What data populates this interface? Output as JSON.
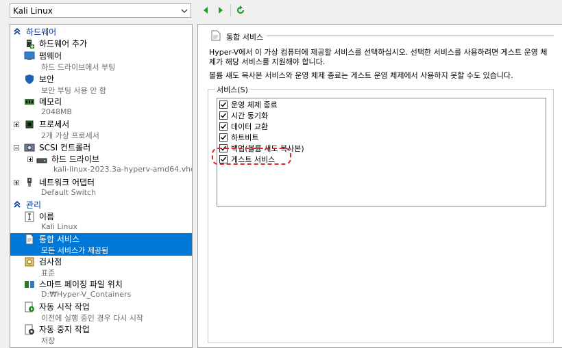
{
  "toolbar": {
    "vm_name": "Kali Linux",
    "back_icon": "arrow-left-icon",
    "forward_icon": "arrow-right-icon",
    "refresh_icon": "refresh-icon",
    "accent_color": "#1e9e2d"
  },
  "left": {
    "hardware_header": "하드웨어",
    "management_header": "관리",
    "items": [
      {
        "label": "하드웨어 추가",
        "sub": ""
      },
      {
        "label": "펌웨어",
        "sub": "하드 드라이브에서 부팅"
      },
      {
        "label": "보안",
        "sub": "보안 부팅 사용 안 함"
      },
      {
        "label": "메모리",
        "sub": "2048MB"
      },
      {
        "label": "프로세서",
        "sub": "2개 가상 프로세서"
      },
      {
        "label": "SCSI 컨트롤러",
        "sub": ""
      },
      {
        "label": "하드 드라이브",
        "sub": "kali-linux-2023.3a-hyperv-amd64.vhdx"
      },
      {
        "label": "네트워크 어댑터",
        "sub": "Default Switch"
      }
    ],
    "mgmt_items": [
      {
        "label": "이름",
        "sub": "Kali Linux"
      },
      {
        "label": "통합 서비스",
        "sub": "모든 서비스가 제공됨"
      },
      {
        "label": "검사점",
        "sub": "표준"
      },
      {
        "label": "스마트 페이징 파일 위치",
        "sub": "D:₩Hyper-V_Containers"
      },
      {
        "label": "자동 시작 작업",
        "sub": "이전에 실행 중인 경우 다시 시작"
      },
      {
        "label": "자동 중지 작업",
        "sub": "저장"
      }
    ],
    "selection_color": "#0078d7"
  },
  "right": {
    "title": "통합 서비스",
    "desc1": "Hyper-V에서 이 가상 컴퓨터에 제공할 서비스를 선택하십시오. 선택한 서비스를 사용하려면 게스트 운영 체제가 해당 서비스를 지원해야 합니다.",
    "desc2": "볼륨 섀도 복사본 서비스와 운영 체제 종료는 게스트 운영 체제에서 사용하지 못할 수도 있습니다.",
    "services_label": "서비스(S)",
    "services": [
      {
        "label": "운영 체제 종료",
        "checked": true
      },
      {
        "label": "시간 동기화",
        "checked": true
      },
      {
        "label": "데이터 교환",
        "checked": true
      },
      {
        "label": "하트비트",
        "checked": true
      },
      {
        "label": "백업(볼륨 섀도 복사본)",
        "checked": true
      },
      {
        "label": "게스트 서비스",
        "checked": true
      }
    ],
    "highlight_color": "#d9262a"
  }
}
